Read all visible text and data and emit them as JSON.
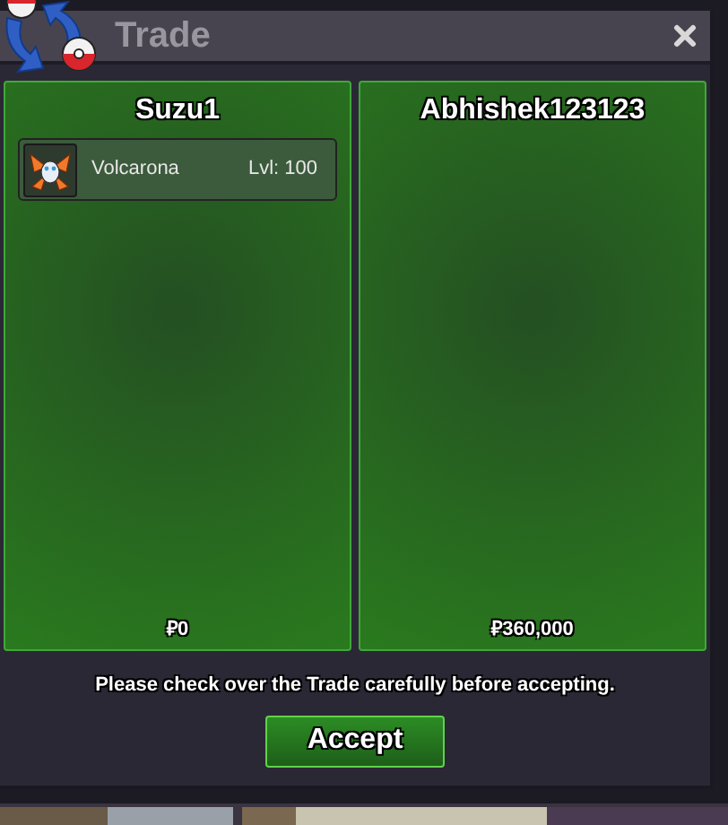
{
  "window": {
    "title": "Trade"
  },
  "panels": [
    {
      "name": "Suzu1",
      "items": [
        {
          "name": "Volcarona",
          "level": "Lvl: 100"
        }
      ],
      "money": "₽0"
    },
    {
      "name": "Abhishek123123",
      "money": "₽360,000"
    }
  ],
  "message": "Please check over the Trade carefully before accepting.",
  "buttons": [
    "Accept"
  ]
}
